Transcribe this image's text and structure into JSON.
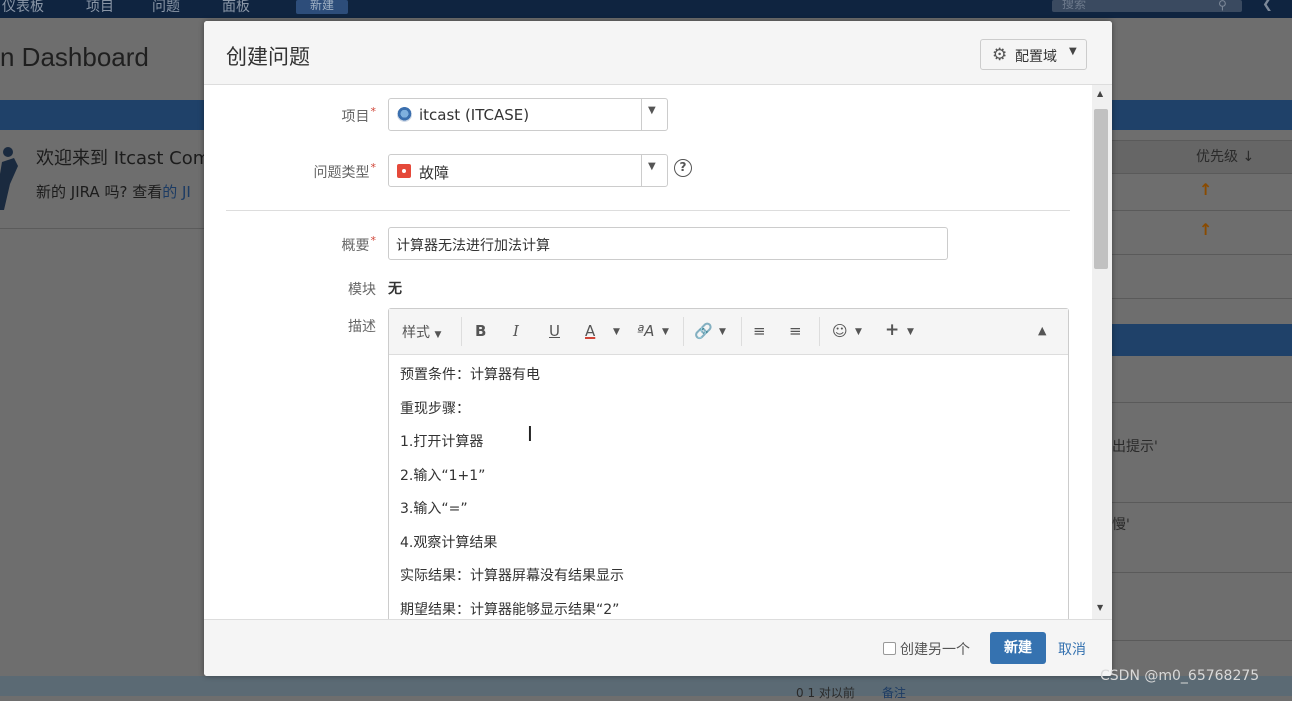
{
  "background": {
    "nav": [
      "仪表板",
      "项目",
      "问题",
      "面板"
    ],
    "nav_create": "新建",
    "nav_search_placeholder": "搜索",
    "page_title": "n Dashboard",
    "welcome_title": "欢迎来到 Itcast Comp",
    "welcome_sub_prefix": "新的 JIRA 吗? 查看",
    "welcome_sub_link": "的 JI",
    "priority_header": "优先级 ↓",
    "priority_arrows": [
      "↑",
      "↑"
    ],
    "snippets": [
      "出提示'",
      "慢'"
    ],
    "footer_time": "0 1 对以前",
    "footer_link": "备注"
  },
  "modal": {
    "title": "创建问题",
    "config_button": "配置域",
    "fields": {
      "project_label": "项目",
      "project_value": "itcast (ITCASE)",
      "issue_type_label": "问题类型",
      "issue_type_value": "故障",
      "summary_label": "概要",
      "summary_value": "计算器无法进行加法计算",
      "module_label": "模块",
      "module_value": "无",
      "description_label": "描述"
    },
    "toolbar": {
      "style": "样式",
      "bold": "B",
      "italic": "I",
      "underline": "U",
      "text_color": "A",
      "text_size": "ªA"
    },
    "description_lines": [
      "预置条件：计算器有电",
      "重现步骤：",
      "1.打开计算器",
      "2.输入“1+1”",
      "3.输入“=”",
      "4.观察计算结果",
      "实际结果：计算器屏幕没有结果显示",
      "期望结果：计算器能够显示结果“2”"
    ],
    "footer": {
      "create_another": "创建另一个",
      "create_button": "新建",
      "cancel": "取消"
    }
  },
  "watermark": "CSDN @m0_65768275",
  "colors": {
    "primary": "#3572b0",
    "required": "#d04437",
    "nav_bg": "#0f2440",
    "bug": "#e5493a"
  }
}
